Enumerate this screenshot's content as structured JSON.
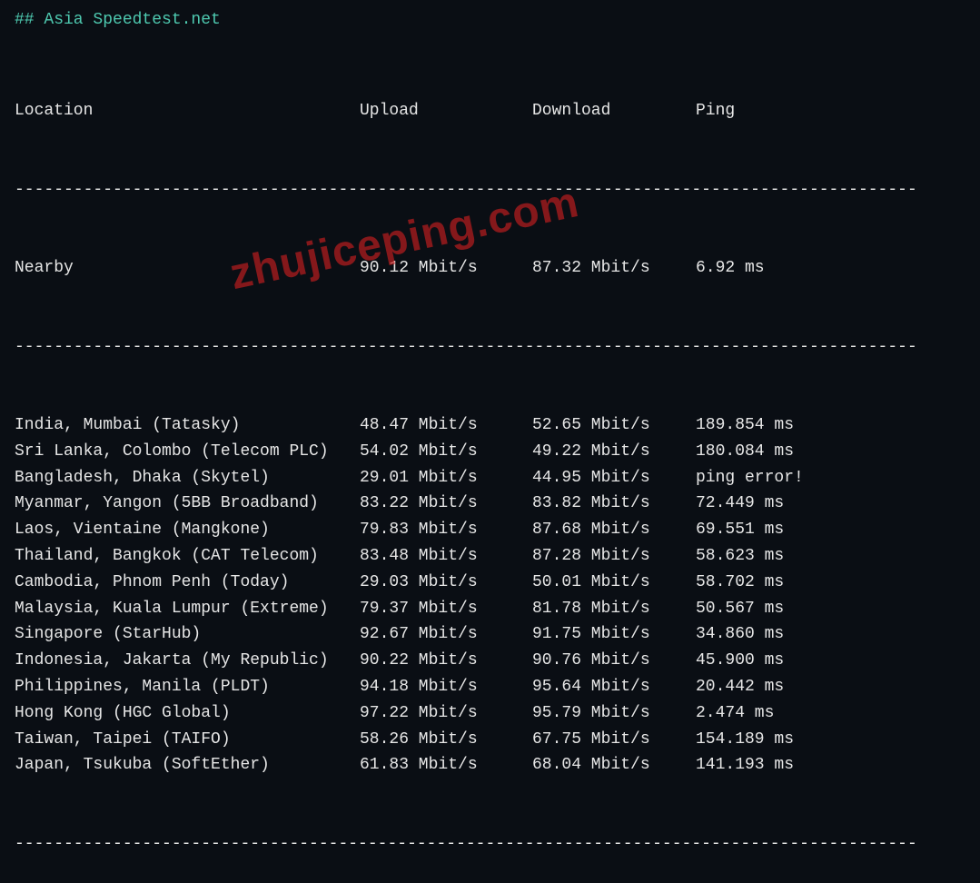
{
  "title": "## Asia Speedtest.net",
  "headers": {
    "location": "Location",
    "upload": "Upload",
    "download": "Download",
    "ping": "Ping"
  },
  "separator": "--------------------------------------------------------------------------------------------",
  "nearby": {
    "location": "Nearby",
    "upload": "90.12 Mbit/s",
    "download": "87.32 Mbit/s",
    "ping": "6.92 ms"
  },
  "rows": [
    {
      "location": "India, Mumbai (Tatasky)",
      "upload": "48.47 Mbit/s",
      "download": "52.65 Mbit/s",
      "ping": "189.854 ms"
    },
    {
      "location": "Sri Lanka, Colombo (Telecom PLC)",
      "upload": "54.02 Mbit/s",
      "download": "49.22 Mbit/s",
      "ping": "180.084 ms"
    },
    {
      "location": "Bangladesh, Dhaka (Skytel)",
      "upload": "29.01 Mbit/s",
      "download": "44.95 Mbit/s",
      "ping": "ping error!"
    },
    {
      "location": "Myanmar, Yangon (5BB Broadband)",
      "upload": "83.22 Mbit/s",
      "download": "83.82 Mbit/s",
      "ping": "72.449 ms"
    },
    {
      "location": "Laos, Vientaine (Mangkone)",
      "upload": "79.83 Mbit/s",
      "download": "87.68 Mbit/s",
      "ping": "69.551 ms"
    },
    {
      "location": "Thailand, Bangkok (CAT Telecom)",
      "upload": "83.48 Mbit/s",
      "download": "87.28 Mbit/s",
      "ping": "58.623 ms"
    },
    {
      "location": "Cambodia, Phnom Penh (Today)",
      "upload": "29.03 Mbit/s",
      "download": "50.01 Mbit/s",
      "ping": "58.702 ms"
    },
    {
      "location": "Malaysia, Kuala Lumpur (Extreme)",
      "upload": "79.37 Mbit/s",
      "download": "81.78 Mbit/s",
      "ping": "50.567 ms"
    },
    {
      "location": "Singapore (StarHub)",
      "upload": "92.67 Mbit/s",
      "download": "91.75 Mbit/s",
      "ping": "34.860 ms"
    },
    {
      "location": "Indonesia, Jakarta (My Republic)",
      "upload": "90.22 Mbit/s",
      "download": "90.76 Mbit/s",
      "ping": "45.900 ms"
    },
    {
      "location": "Philippines, Manila (PLDT)",
      "upload": "94.18 Mbit/s",
      "download": "95.64 Mbit/s",
      "ping": "20.442 ms"
    },
    {
      "location": "Hong Kong (HGC Global)",
      "upload": "97.22 Mbit/s",
      "download": "95.79 Mbit/s",
      "ping": "2.474 ms"
    },
    {
      "location": "Taiwan, Taipei (TAIFO)",
      "upload": "58.26 Mbit/s",
      "download": "67.75 Mbit/s",
      "ping": "154.189 ms"
    },
    {
      "location": "Japan, Tsukuba (SoftEther)",
      "upload": "61.83 Mbit/s",
      "download": "68.04 Mbit/s",
      "ping": "141.193 ms"
    }
  ],
  "watermark": "zhujiceping.com"
}
